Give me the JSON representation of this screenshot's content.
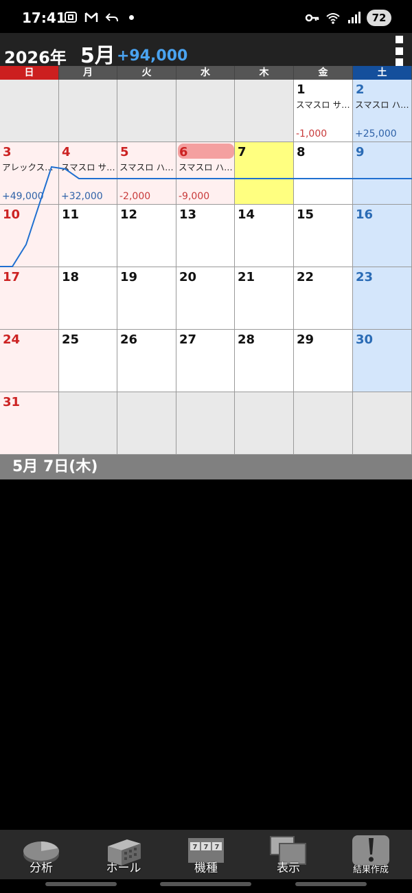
{
  "status_bar": {
    "time": "17:41",
    "battery": "72"
  },
  "header": {
    "year": "2026年",
    "month": "5月",
    "total": "+94,000"
  },
  "weekdays": [
    "日",
    "月",
    "火",
    "水",
    "木",
    "金",
    "土"
  ],
  "calendar": {
    "rows": [
      [
        {
          "day": "",
          "type": "empty"
        },
        {
          "day": "",
          "type": "empty"
        },
        {
          "day": "",
          "type": "empty"
        },
        {
          "day": "",
          "type": "empty"
        },
        {
          "day": "",
          "type": "empty"
        },
        {
          "day": "1",
          "type": "weekday",
          "entry": "スマスロ サ…",
          "amount": "-1,000",
          "sign": "neg"
        },
        {
          "day": "2",
          "type": "sat",
          "entry": "スマスロ ハ…",
          "amount": "+25,000",
          "sign": "pos"
        }
      ],
      [
        {
          "day": "3",
          "type": "sun",
          "entry": "アレックス…",
          "amount": "+49,000",
          "sign": "pos"
        },
        {
          "day": "4",
          "type": "weekday-pink",
          "entry": "スマスロ サ…",
          "amount": "+32,000",
          "sign": "pos"
        },
        {
          "day": "5",
          "type": "weekday-pink",
          "entry": "スマスロ ハ…",
          "amount": "-2,000",
          "sign": "neg"
        },
        {
          "day": "6",
          "type": "weekday-pink-selected",
          "entry": "スマスロ ハ…",
          "amount": "-9,000",
          "sign": "neg"
        },
        {
          "day": "7",
          "type": "today"
        },
        {
          "day": "8",
          "type": "weekday"
        },
        {
          "day": "9",
          "type": "sat"
        }
      ],
      [
        {
          "day": "10",
          "type": "sun"
        },
        {
          "day": "11",
          "type": "weekday"
        },
        {
          "day": "12",
          "type": "weekday"
        },
        {
          "day": "13",
          "type": "weekday"
        },
        {
          "day": "14",
          "type": "weekday"
        },
        {
          "day": "15",
          "type": "weekday"
        },
        {
          "day": "16",
          "type": "sat"
        }
      ],
      [
        {
          "day": "17",
          "type": "sun"
        },
        {
          "day": "18",
          "type": "weekday"
        },
        {
          "day": "19",
          "type": "weekday"
        },
        {
          "day": "20",
          "type": "weekday"
        },
        {
          "day": "21",
          "type": "weekday"
        },
        {
          "day": "22",
          "type": "weekday"
        },
        {
          "day": "23",
          "type": "sat"
        }
      ],
      [
        {
          "day": "24",
          "type": "sun"
        },
        {
          "day": "25",
          "type": "weekday"
        },
        {
          "day": "26",
          "type": "weekday"
        },
        {
          "day": "27",
          "type": "weekday"
        },
        {
          "day": "28",
          "type": "weekday"
        },
        {
          "day": "29",
          "type": "weekday"
        },
        {
          "day": "30",
          "type": "sat"
        }
      ],
      [
        {
          "day": "31",
          "type": "sun"
        },
        {
          "day": "",
          "type": "empty"
        },
        {
          "day": "",
          "type": "empty"
        },
        {
          "day": "",
          "type": "empty"
        },
        {
          "day": "",
          "type": "empty"
        },
        {
          "day": "",
          "type": "empty"
        },
        {
          "day": "",
          "type": "empty"
        }
      ]
    ]
  },
  "selected_date": "5月  7日(木)",
  "toolbar": [
    {
      "label": "分析",
      "icon": "pie-chart-icon"
    },
    {
      "label": "ホール",
      "icon": "building-icon"
    },
    {
      "label": "機種",
      "icon": "slot-machine-icon"
    },
    {
      "label": "表示",
      "icon": "display-windows-icon"
    },
    {
      "label": "結果作成",
      "icon": "exclamation-icon"
    }
  ],
  "colors": {
    "sunday": "#cc1f1f",
    "saturday": "#144f9c",
    "today": "#ffff80",
    "positive": "#2f62a8",
    "negative": "#c83a3a",
    "graph_line": "#1f6fd0"
  }
}
